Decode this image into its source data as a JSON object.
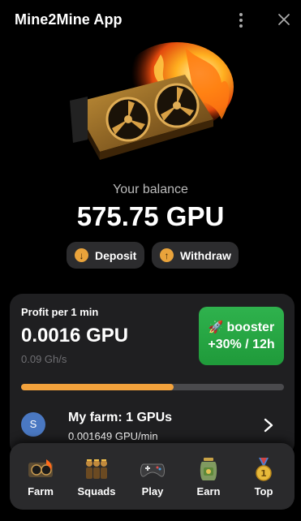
{
  "header": {
    "title": "Mine2Mine App"
  },
  "balance": {
    "label": "Your balance",
    "value": "575.75 GPU"
  },
  "actions": {
    "deposit_label": "Deposit",
    "withdraw_label": "Withdraw",
    "deposit_icon": "arrow-down-icon",
    "withdraw_icon": "arrow-up-icon",
    "icon_color": "#e9a33b"
  },
  "profit": {
    "label": "Profit per 1 min",
    "value": "0.0016 GPU",
    "hashrate": "0.09 Gh/s",
    "progress_fraction": 0.58,
    "progress_color": "#f3a23c"
  },
  "booster": {
    "line1": "booster",
    "line2": "+30% / 12h",
    "color": "#2fb24d"
  },
  "farm": {
    "avatar_letter": "S",
    "title": "My farm: 1 GPUs",
    "rate": "0.001649 GPU/min"
  },
  "nav": {
    "items": [
      {
        "label": "Farm",
        "icon": "gpu-icon"
      },
      {
        "label": "Squads",
        "icon": "miners-icon"
      },
      {
        "label": "Play",
        "icon": "gamepad-icon"
      },
      {
        "label": "Earn",
        "icon": "money-jar-icon"
      },
      {
        "label": "Top",
        "icon": "medal-icon"
      }
    ]
  }
}
